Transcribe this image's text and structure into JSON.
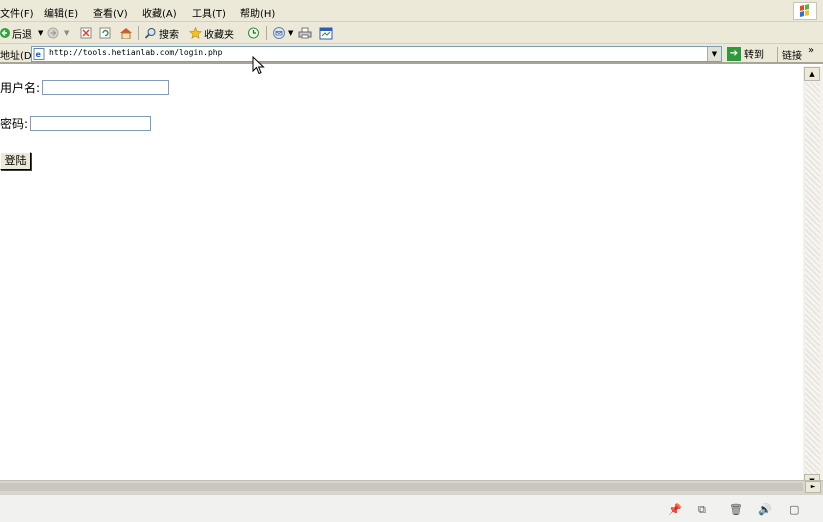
{
  "menubar": {
    "items": [
      "文件(F)",
      "编辑(E)",
      "查看(V)",
      "收藏(A)",
      "工具(T)",
      "帮助(H)"
    ]
  },
  "toolbar": {
    "back_label": "后退",
    "search_label": "搜索",
    "favorites_label": "收藏夹"
  },
  "addressbar": {
    "label": "地址(D)",
    "url": "http://tools.hetianlab.com/login.php",
    "go_label": "转到",
    "links_label": "链接",
    "more_label": "»"
  },
  "form": {
    "username_label": "用户名:",
    "username_value": "",
    "password_label": "密码:",
    "password_value": "",
    "login_button": "登陆"
  },
  "icons": {
    "back": "back-arrow-icon",
    "forward": "forward-arrow-icon",
    "stop": "stop-icon",
    "refresh": "refresh-icon",
    "home": "home-icon",
    "search": "magnifier-icon",
    "favorites": "star-icon",
    "history": "history-icon",
    "mail": "mail-icon",
    "print": "printer-icon",
    "edit": "edit-icon"
  }
}
